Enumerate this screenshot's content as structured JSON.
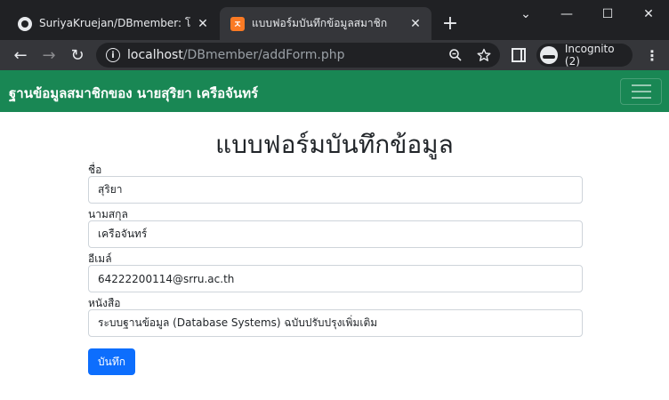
{
  "browser": {
    "tabs": [
      {
        "title": "SuriyaKruejan/DBmember: โจทย์แ",
        "close": "✕"
      },
      {
        "title": "แบบฟอร์มบันทึกข้อมูลสมาชิก",
        "close": "✕"
      }
    ],
    "new_tab": "+",
    "window_controls": {
      "dropdown": "⌄",
      "minimize": "—",
      "maximize": "☐",
      "close": "✕"
    },
    "nav": {
      "back": "←",
      "forward": "→",
      "reload": "↻"
    },
    "url": {
      "host": "localhost",
      "path": "/DBmember/addForm.php"
    },
    "incognito_label": "Incognito (2)",
    "menu": "⋮"
  },
  "navbar": {
    "brand": "ฐานข้อมูลสมาชิกของ นายสุริยา เครือจันทร์"
  },
  "form": {
    "title": "แบบฟอร์มบันทึกข้อมูล",
    "fields": [
      {
        "label": "ชื่อ",
        "value": "สุริยา"
      },
      {
        "label": "นามสกุล",
        "value": "เครือจันทร์"
      },
      {
        "label": "อีเมล์",
        "value": "64222200114@srru.ac.th"
      },
      {
        "label": "หนังสือ",
        "value": "ระบบฐานข้อมูล (Database Systems) ฉบับปรับปรุงเพิ่มเติม"
      }
    ],
    "submit_label": "บันทึก"
  },
  "colors": {
    "navbar": "#198754",
    "submit": "#0d6efd"
  }
}
